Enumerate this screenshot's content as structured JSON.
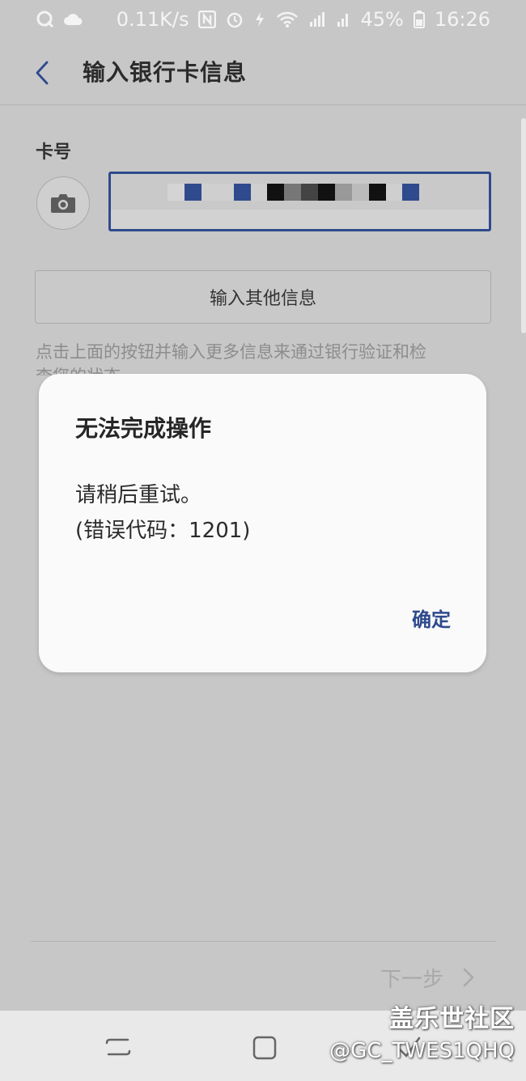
{
  "status_bar": {
    "speed": "0.11K/s",
    "battery": "45%",
    "time": "16:26",
    "icons": [
      "q-app-icon",
      "cloud-icon",
      "nfc-icon",
      "alarm-icon",
      "data-icon",
      "wifi-icon",
      "signal-icon",
      "signal-icon",
      "battery-icon"
    ]
  },
  "app_bar": {
    "title": "输入银行卡信息",
    "back_icon": "chevron-left-icon"
  },
  "form": {
    "card_label": "卡号",
    "camera_icon": "camera-icon",
    "other_info_button": "输入其他信息",
    "hint": "点击上面的按钮并输入更多信息来通过银行验证和检查您的状态"
  },
  "dialog": {
    "title": "无法完成操作",
    "message_line1": "请稍后重试。",
    "message_line2": "(错误代码：1201)",
    "ok_button": "确定"
  },
  "footer": {
    "next_button": "下一步",
    "next_icon": "chevron-right-icon"
  },
  "nav_bar": {
    "icons": [
      "recent-apps-icon",
      "home-icon",
      "back-icon"
    ]
  },
  "watermark": {
    "line1": "盖乐世社区",
    "line2": "@GC_TWES1QHQ"
  },
  "colors": {
    "accent": "#2f4a8d",
    "background": "#c7c7c7",
    "dialog": "#fafafa"
  }
}
